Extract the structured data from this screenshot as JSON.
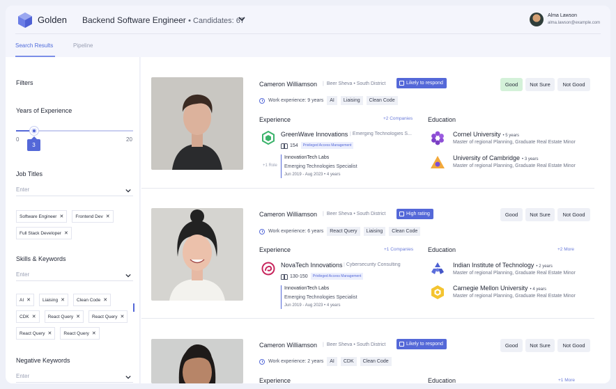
{
  "app": {
    "logo_text": "Golden"
  },
  "header": {
    "job_title": "Backend Software Engineer",
    "candidates_label": "• Candidates: 67",
    "user_name": "Alma Lawson",
    "user_email": "alma.lawson@example.com"
  },
  "tabs": [
    {
      "label": "Search Results",
      "active": true
    },
    {
      "label": "Pipeline",
      "active": false
    }
  ],
  "colors": {
    "accent": "#5468d8",
    "good_selected": "#d4f1d9"
  },
  "filters": {
    "title": "Filters",
    "years": {
      "label": "Years of Experience",
      "min": "0",
      "max": "20",
      "value": "3"
    },
    "job_titles": {
      "label": "Job Titles",
      "placeholder": "Enter",
      "chips": [
        "Software Engineer",
        "Frontend Dev",
        "Full Stack Developer"
      ]
    },
    "skills": {
      "label": "Skills & Keywords",
      "placeholder": "Enter",
      "chips": [
        "AI",
        "Liaising",
        "Clean Code",
        "CDK",
        "React Query",
        "React Query",
        "React Query",
        "React Query"
      ]
    },
    "negative": {
      "label": "Negative Keywords",
      "placeholder": "Enter"
    }
  },
  "candidates": [
    {
      "name": "Cameron Williamson",
      "location": "Beer Sheva • South District",
      "flag": "Likely to respond",
      "rating_selected": "Good",
      "ratings": [
        "Good",
        "Not Sure",
        "Not Good"
      ],
      "experience_years": "Work experience: 9 years",
      "tags": [
        "AI",
        "Liaising",
        "Clean Code"
      ],
      "experience_label": "Experience",
      "experience_more": "+2 Companies",
      "company": {
        "name": "GreenWave Innovations",
        "industry": "Emerging Technologies S...",
        "employees": "154",
        "badge": "Privileged Access Management",
        "logo": "hexagon-icon"
      },
      "role_count": "+1 Role",
      "role": {
        "company": "InnovationTech Labs",
        "title": "Emerging Technologies Specialist",
        "dates": "Jun 2019 - Aug 2023 • 4 years"
      },
      "education_label": "Education",
      "education_more": "",
      "education": [
        {
          "name": "Cornel University",
          "years": "• 5 years",
          "degree": "Master of regional Planning, Graduate Real Estate Minor",
          "logo": "flower-icon"
        },
        {
          "name": "University of Cambridge",
          "years": "• 3 years",
          "degree": "Master of regional Planning, Graduate Real Estate Minor",
          "logo": "triangle-icon"
        }
      ]
    },
    {
      "name": "Cameron Williamson",
      "location": "Beer Sheva • South District",
      "flag": "High rating",
      "rating_selected": "",
      "ratings": [
        "Good",
        "Not Sure",
        "Not Good"
      ],
      "experience_years": "Work experience: 6 years",
      "tags": [
        "React Query",
        "Liaising",
        "Clean Code"
      ],
      "experience_label": "Experience",
      "experience_more": "+1 Companies",
      "company": {
        "name": "NovaTech Innovations",
        "industry": "Cybersecurity Consulting",
        "employees": "130-150",
        "badge": "Privileged Access Management",
        "logo": "swirl-icon"
      },
      "role_count": "",
      "role": {
        "company": "InnovationTech Labs",
        "title": "Emerging Technologies Specialist",
        "dates": "Jun 2019 - Aug 2023 • 4 years"
      },
      "education_label": "Education",
      "education_more": "+2 More",
      "education": [
        {
          "name": "Indian Institute of Technology",
          "years": "• 2 years",
          "degree": "Master of regional Planning, Graduate Real Estate Minor",
          "logo": "tri-blob-icon"
        },
        {
          "name": "Carnegie Mellon University",
          "years": "• 4 years",
          "degree": "Master of regional Planning, Graduate Real Estate Minor",
          "logo": "hexagon-gold-icon"
        }
      ]
    },
    {
      "name": "Cameron Williamson",
      "location": "Beer Sheva • South District",
      "flag": "Likely to respond",
      "rating_selected": "",
      "ratings": [
        "Good",
        "Not Sure",
        "Not Good"
      ],
      "experience_years": "Work experience: 2 years",
      "tags": [
        "AI",
        "CDK",
        "Clean Code"
      ],
      "experience_label": "Experience",
      "education_label": "Education",
      "education_more": "+1 More"
    }
  ]
}
